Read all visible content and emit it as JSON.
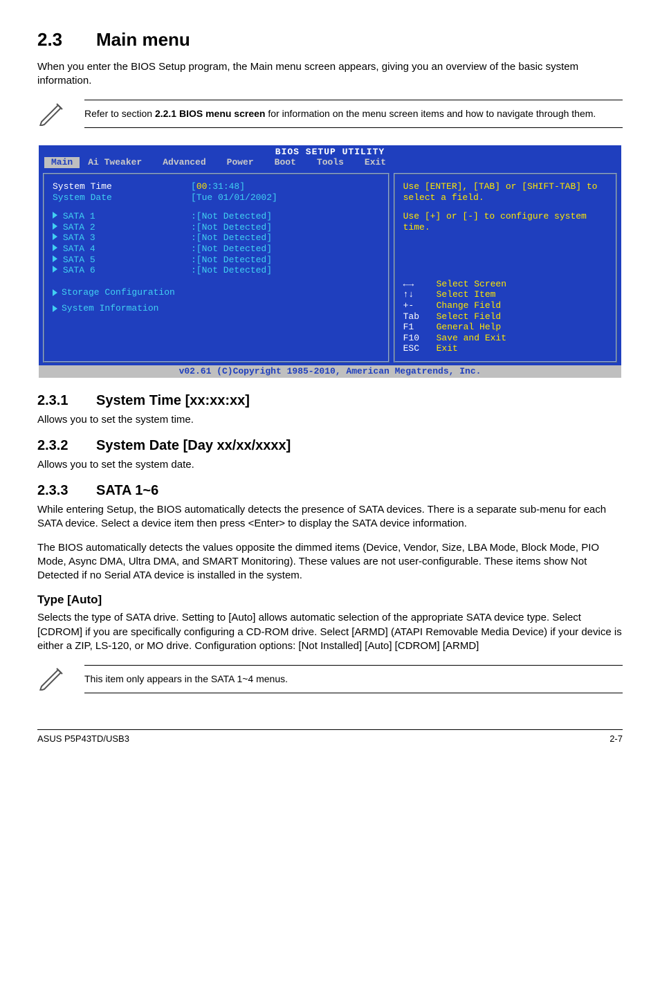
{
  "section": {
    "number": "2.3",
    "title": "Main menu"
  },
  "intro": "When you enter the BIOS Setup program, the Main menu screen appears, giving you an overview of the basic system information.",
  "note1_a": "Refer to section ",
  "note1_b": "2.2.1 BIOS menu screen",
  "note1_c": " for information on the menu screen items and how to navigate through them.",
  "bios": {
    "title": "BIOS SETUP UTILITY",
    "menus": [
      "Main",
      "Ai Tweaker",
      "Advanced",
      "Power",
      "Boot",
      "Tools",
      "Exit"
    ],
    "rows_top": [
      {
        "label": "System Time",
        "value_pre": "[",
        "value_hl": "00",
        "value_post": ":31:48]"
      },
      {
        "label": "System Date",
        "value": "[Tue 01/01/2002]"
      }
    ],
    "sata": [
      {
        "label": "SATA 1",
        "value": ":[Not Detected]"
      },
      {
        "label": "SATA 2",
        "value": ":[Not Detected]"
      },
      {
        "label": "SATA 3",
        "value": ":[Not Detected]"
      },
      {
        "label": "SATA 4",
        "value": ":[Not Detected]"
      },
      {
        "label": "SATA 5",
        "value": ":[Not Detected]"
      },
      {
        "label": "SATA 6",
        "value": ":[Not Detected]"
      }
    ],
    "subitems": [
      "Storage Configuration",
      "System Information"
    ],
    "help1": "Use [ENTER], [TAB] or [SHIFT-TAB] to select a field.",
    "help2": "Use [+] or [-] to configure system time.",
    "keys": [
      {
        "k": "←→",
        "d": "Select Screen"
      },
      {
        "k": "↑↓",
        "d": "Select Item"
      },
      {
        "k": "+-",
        "d": "Change Field"
      },
      {
        "k": "Tab",
        "d": "Select Field"
      },
      {
        "k": "F1",
        "d": "General Help"
      },
      {
        "k": "F10",
        "d": "Save and Exit"
      },
      {
        "k": "ESC",
        "d": "Exit"
      }
    ],
    "footer": "v02.61 (C)Copyright 1985-2010, American Megatrends, Inc."
  },
  "s231": {
    "num": "2.3.1",
    "title": "System Time [xx:xx:xx]",
    "body": "Allows you to set the system time."
  },
  "s232": {
    "num": "2.3.2",
    "title": "System Date [Day xx/xx/xxxx]",
    "body": "Allows you to set the system date."
  },
  "s233": {
    "num": "2.3.3",
    "title": "SATA 1~6",
    "p1": "While entering Setup, the BIOS automatically detects the presence of SATA devices. There is a separate sub-menu for each SATA device. Select a device item then press <Enter> to display the SATA device information.",
    "p2": "The BIOS automatically detects the values opposite the dimmed items (Device, Vendor, Size, LBA Mode, Block Mode, PIO Mode, Async DMA, Ultra DMA, and SMART Monitoring). These values are not user-configurable. These items show Not Detected if no Serial ATA device is installed in the system."
  },
  "type": {
    "title": "Type [Auto]",
    "body": "Selects the type of SATA drive. Setting to [Auto] allows automatic selection of the appropriate SATA device type. Select [CDROM] if you are specifically configuring a CD-ROM drive. Select [ARMD] (ATAPI Removable Media Device) if your device is either a ZIP, LS-120, or MO drive. Configuration options: [Not Installed] [Auto] [CDROM] [ARMD]"
  },
  "note2": "This item only appears in the SATA 1~4 menus.",
  "footer": {
    "left": "ASUS P5P43TD/USB3",
    "right": "2-7"
  },
  "chart_data": {
    "type": "table",
    "title": "BIOS Main menu – displayed items and values",
    "series": [
      {
        "name": "System Time",
        "values": [
          "00:31:48"
        ]
      },
      {
        "name": "System Date",
        "values": [
          "Tue 01/01/2002"
        ]
      },
      {
        "name": "SATA 1",
        "values": [
          "Not Detected"
        ]
      },
      {
        "name": "SATA 2",
        "values": [
          "Not Detected"
        ]
      },
      {
        "name": "SATA 3",
        "values": [
          "Not Detected"
        ]
      },
      {
        "name": "SATA 4",
        "values": [
          "Not Detected"
        ]
      },
      {
        "name": "SATA 5",
        "values": [
          "Not Detected"
        ]
      },
      {
        "name": "SATA 6",
        "values": [
          "Not Detected"
        ]
      }
    ]
  }
}
